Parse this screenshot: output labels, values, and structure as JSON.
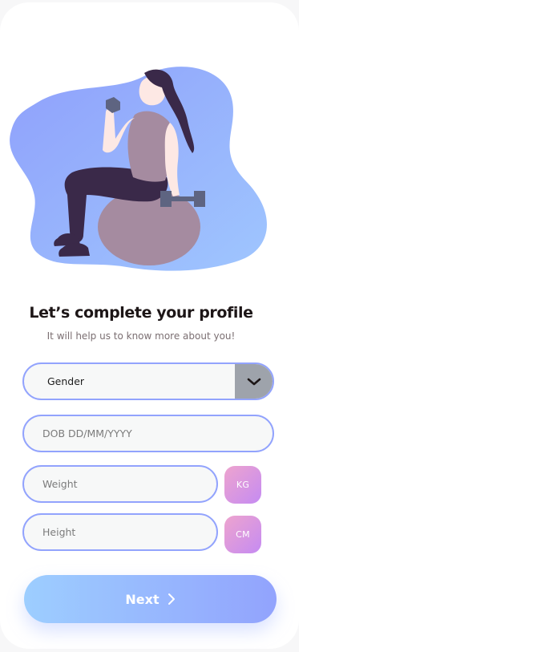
{
  "page": {
    "title": "Let’s complete your profile",
    "subtitle": "It will help us to know more about you!"
  },
  "form": {
    "gender": {
      "label": "Gender",
      "icon": "chevron-down-icon"
    },
    "dob": {
      "placeholder": "DOB DD/MM/YYYY"
    },
    "weight": {
      "placeholder": "Weight",
      "unit": "KG"
    },
    "height": {
      "placeholder": "Height",
      "unit": "CM"
    }
  },
  "actions": {
    "next_label": "Next",
    "next_icon": "chevron-right-icon"
  },
  "colors": {
    "accent_border": "#92a3fd",
    "unit_gradient_start": "#eea4ce",
    "unit_gradient_end": "#c58bf2",
    "button_gradient_start": "#9dceff",
    "button_gradient_end": "#92a3fd",
    "dropdown_bg": "#9ea3ab"
  }
}
